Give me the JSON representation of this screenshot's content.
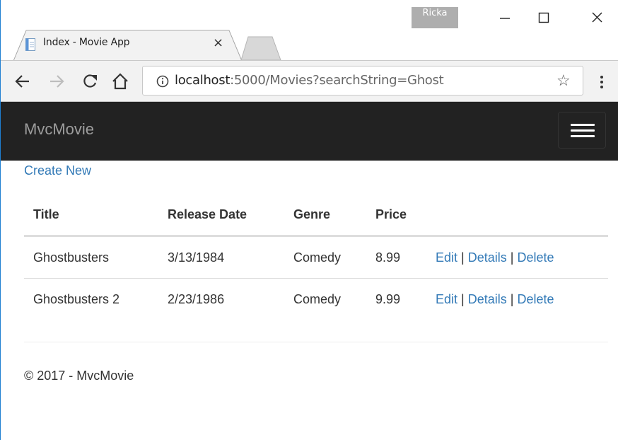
{
  "browser": {
    "user": "Ricka",
    "tab_title": "Index - Movie App",
    "tab_close": "×",
    "url_host": "localhost",
    "url_rest": ":5000/Movies?searchString=Ghost",
    "icons": [
      "back-arrow-icon",
      "forward-arrow-icon",
      "reload-icon",
      "home-icon",
      "info-icon",
      "star-icon",
      "menu-dots-icon",
      "minimize-icon",
      "maximize-icon",
      "close-icon",
      "page-icon"
    ]
  },
  "app": {
    "brand": "MvcMovie",
    "create_new": "Create New",
    "headers": {
      "title": "Title",
      "release_date": "Release Date",
      "genre": "Genre",
      "price": "Price"
    },
    "movies": [
      {
        "title": "Ghostbusters",
        "release_date": "3/13/1984",
        "genre": "Comedy",
        "price": "8.99"
      },
      {
        "title": "Ghostbusters 2",
        "release_date": "2/23/1986",
        "genre": "Comedy",
        "price": "9.99"
      }
    ],
    "actions": {
      "edit": "Edit",
      "details": "Details",
      "delete": "Delete",
      "separator": "|"
    },
    "footer": "© 2017 - MvcMovie",
    "colors": {
      "navbar": "#222222",
      "link": "#337ab7",
      "brand_text": "#9d9d9d"
    }
  }
}
